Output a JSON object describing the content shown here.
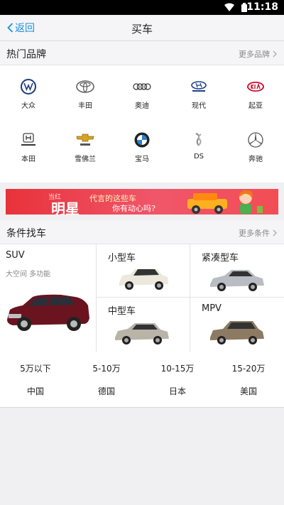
{
  "status": {
    "time": "11:18"
  },
  "nav": {
    "back_label": "返回",
    "title": "买车"
  },
  "hot_brands": {
    "title": "热门品牌",
    "more": "更多品牌",
    "items": [
      {
        "name": "大众",
        "icon": "volkswagen-logo-icon"
      },
      {
        "name": "丰田",
        "icon": "toyota-logo-icon"
      },
      {
        "name": "奥迪",
        "icon": "audi-logo-icon"
      },
      {
        "name": "现代",
        "icon": "hyundai-logo-icon"
      },
      {
        "name": "起亚",
        "icon": "kia-logo-icon"
      },
      {
        "name": "本田",
        "icon": "honda-logo-icon"
      },
      {
        "name": "雪佛兰",
        "icon": "chevrolet-logo-icon"
      },
      {
        "name": "宝马",
        "icon": "bmw-logo-icon"
      },
      {
        "name": "DS",
        "icon": "ds-logo-icon"
      },
      {
        "name": "奔驰",
        "icon": "mercedes-logo-icon"
      }
    ]
  },
  "banner": {
    "line1": "当红",
    "line2": "明星",
    "line3": "代言的这些车",
    "line4": "你有动心吗?"
  },
  "conditions": {
    "title": "条件找车",
    "more": "更多条件",
    "suv": {
      "title": "SUV",
      "subtitle": "大空间 多功能"
    },
    "small": {
      "title": "小型车"
    },
    "compact": {
      "title": "紧凑型车"
    },
    "mid": {
      "title": "中型车"
    },
    "mpv": {
      "title": "MPV"
    },
    "prices": [
      "5万以下",
      "5-10万",
      "10-15万",
      "15-20万"
    ],
    "countries": [
      "中国",
      "德国",
      "日本",
      "美国"
    ]
  }
}
